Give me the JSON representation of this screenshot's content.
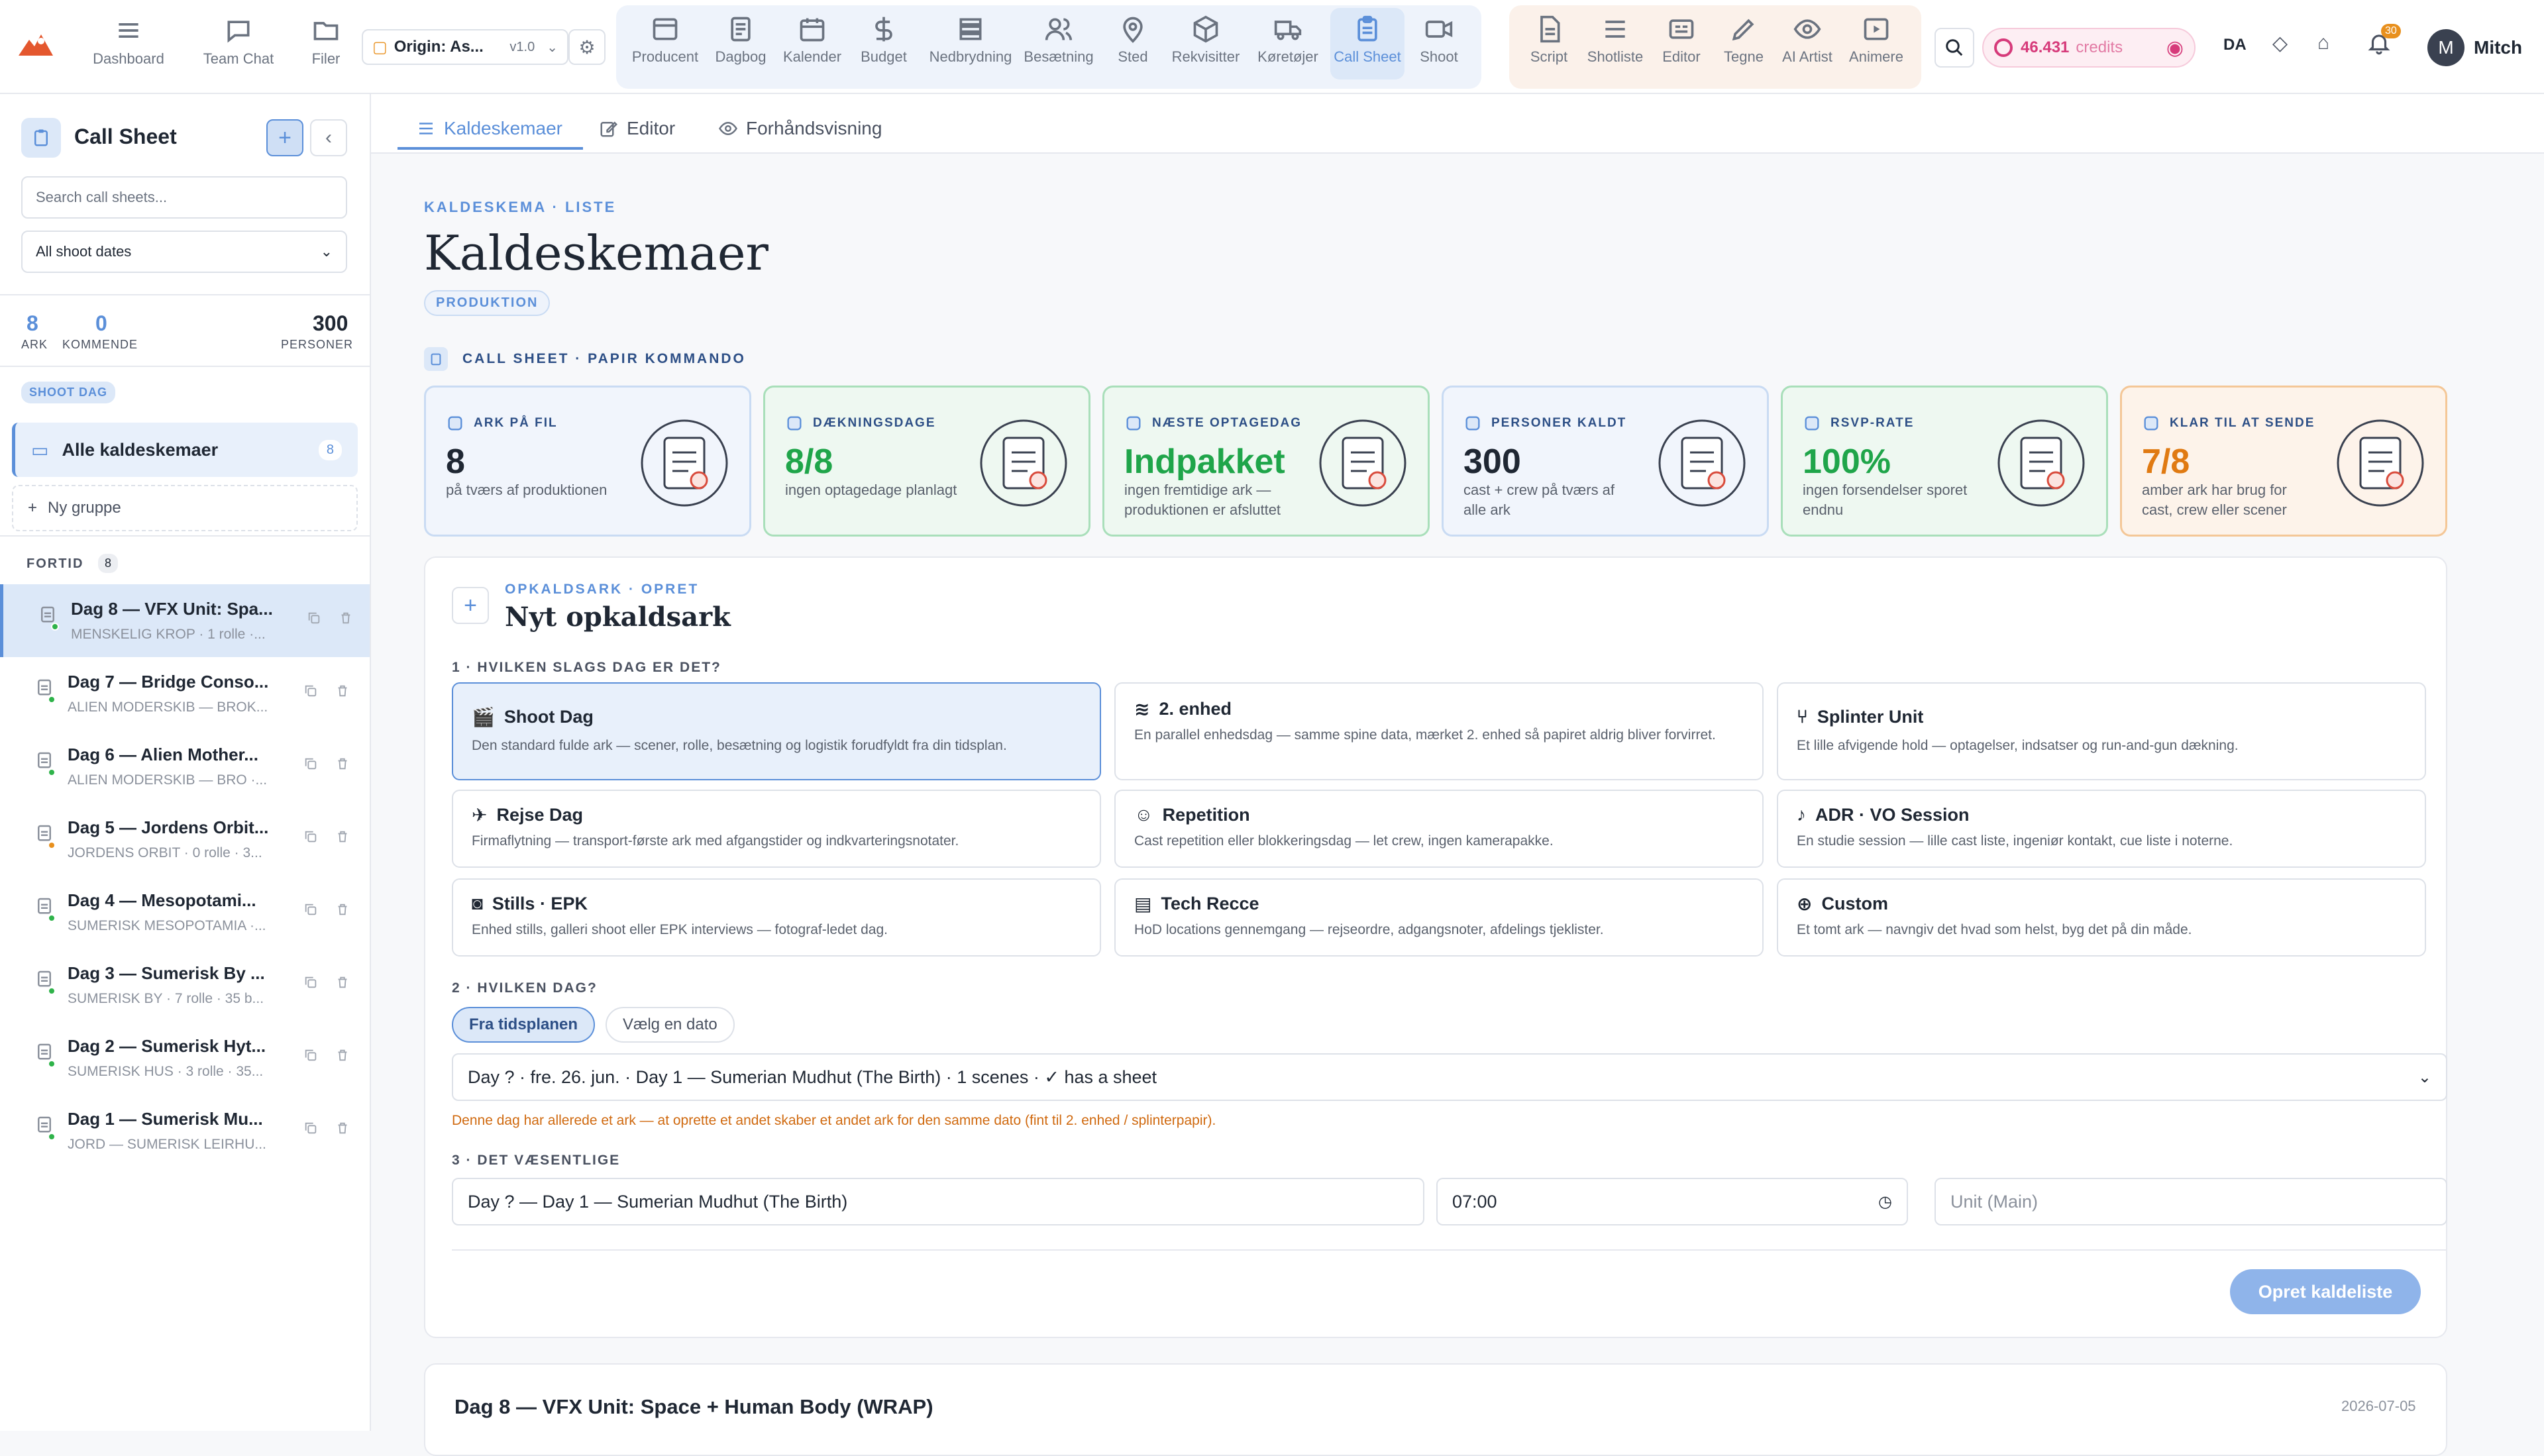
{
  "topbar": {
    "nav": [
      {
        "label": "Dashboard",
        "icon": "grid-icon"
      },
      {
        "label": "Team Chat",
        "icon": "chat-icon"
      },
      {
        "label": "Filer",
        "icon": "folder-icon"
      }
    ],
    "project": {
      "name": "Origin: As...",
      "version": "v1.0"
    },
    "tools_blue": [
      {
        "label": "Producent",
        "icon": "window-icon"
      },
      {
        "label": "Dagbog",
        "icon": "document-icon"
      },
      {
        "label": "Kalender",
        "icon": "calendar-icon"
      },
      {
        "label": "Budget",
        "icon": "dollar-icon"
      },
      {
        "label": "Nedbrydning",
        "icon": "stack-icon"
      },
      {
        "label": "Besætning",
        "icon": "people-icon"
      },
      {
        "label": "Sted",
        "icon": "pin-icon"
      },
      {
        "label": "Rekvisitter",
        "icon": "box-icon"
      },
      {
        "label": "Køretøjer",
        "icon": "truck-icon"
      },
      {
        "label": "Call Sheet",
        "icon": "clipboard-icon"
      },
      {
        "label": "Shoot",
        "icon": "camera-icon"
      }
    ],
    "tools_orange": [
      {
        "label": "Script",
        "icon": "script-icon"
      },
      {
        "label": "Shotliste",
        "icon": "list-icon"
      },
      {
        "label": "Editor",
        "icon": "editor-icon"
      },
      {
        "label": "Tegne",
        "icon": "pencil-icon"
      },
      {
        "label": "AI Artist",
        "icon": "eye-icon"
      },
      {
        "label": "Animere",
        "icon": "play-icon"
      }
    ],
    "credits": "46.431",
    "credits_label": "credits",
    "lang": "DA",
    "notifications": "30",
    "user_initial": "M",
    "user_name": "Mitch"
  },
  "sidebar": {
    "title": "Call Sheet",
    "search_placeholder": "Search call sheets...",
    "filter": "All shoot dates",
    "stats": [
      {
        "num": "8",
        "label": "ARK"
      },
      {
        "num": "0",
        "label": "KOMMENDE"
      },
      {
        "num": "300",
        "label": "PERSONER"
      }
    ],
    "shoot_tag": "SHOOT DAG",
    "all_label": "Alle kaldeskemaer",
    "all_count": "8",
    "new_group": "Ny gruppe",
    "past_label": "FORTID",
    "past_count": "8",
    "sheets": [
      {
        "title": "Dag 8 — VFX Unit: Spa...",
        "sub": "MENSKELIG KROP · 1 rolle ·...",
        "dot": "#2fb34a"
      },
      {
        "title": "Dag 7 — Bridge Conso...",
        "sub": "ALIEN MODERSKIB — BROK...",
        "dot": "#2fb34a"
      },
      {
        "title": "Dag 6 — Alien Mother...",
        "sub": "ALIEN MODERSKIB — BRO ·...",
        "dot": "#2fb34a"
      },
      {
        "title": "Dag 5 — Jordens Orbit...",
        "sub": "JORDENS ORBIT · 0 rolle · 3...",
        "dot": "#e8901e"
      },
      {
        "title": "Dag 4 — Mesopotami...",
        "sub": "SUMERISK MESOPOTAMIA ·...",
        "dot": "#2fb34a"
      },
      {
        "title": "Dag 3 — Sumerisk By ...",
        "sub": "SUMERISK BY · 7 rolle · 35 b...",
        "dot": "#2fb34a"
      },
      {
        "title": "Dag 2 — Sumerisk Hyt...",
        "sub": "SUMERISK HUS · 3 rolle · 35...",
        "dot": "#2fb34a"
      },
      {
        "title": "Dag 1 — Sumerisk Mu...",
        "sub": "JORD — SUMERISK LEIRHU...",
        "dot": "#2fb34a"
      }
    ]
  },
  "tabs": [
    {
      "label": "Kaldeskemaer",
      "icon": "list-icon"
    },
    {
      "label": "Editor",
      "icon": "edit-icon"
    },
    {
      "label": "Forhåndsvisning",
      "icon": "eye-icon"
    }
  ],
  "header": {
    "crumb": "KALDESKEMA · LISTE",
    "title": "Kaldeskemaer",
    "badge": "PRODUKTION",
    "sublabel": "CALL SHEET · PAPIR KOMMANDO"
  },
  "kpis": [
    {
      "label": "ARK PÅ FIL",
      "value": "8",
      "desc": "på tværs af produktionen",
      "theme": "blue"
    },
    {
      "label": "DÆKNINGSDAGE",
      "value": "8/8",
      "desc": "ingen optagedage planlagt",
      "theme": "green"
    },
    {
      "label": "NÆSTE OPTAGEDAG",
      "value": "Indpakket",
      "desc": "ingen fremtidige ark — produktionen er afsluttet",
      "theme": "green"
    },
    {
      "label": "PERSONER KALDT",
      "value": "300",
      "desc": "cast + crew på tværs af alle ark",
      "theme": "blue"
    },
    {
      "label": "RSVP-RATE",
      "value": "100%",
      "desc": "ingen forsendelser sporet endnu",
      "theme": "green"
    },
    {
      "label": "KLAR TIL AT SENDE",
      "value": "7/8",
      "desc": "amber ark har brug for cast, crew eller scener",
      "theme": "orange"
    }
  ],
  "newsheet": {
    "crumb": "OPKALDSARK · OPRET",
    "title": "Nyt opkaldsark",
    "q1": "1 · HVILKEN SLAGS DAG ER DET?",
    "types": [
      {
        "title": "Shoot Dag",
        "desc": "Den standard fulde ark — scener, rolle, besætning og logistik forudfyldt fra din tidsplan.",
        "icon": "clapper-icon",
        "selected": true
      },
      {
        "title": "2. enhed",
        "desc": "En parallel enhedsdag — samme spine data, mærket 2. enhed så papiret aldrig bliver forvirret.",
        "icon": "layers-icon",
        "selected": false
      },
      {
        "title": "Splinter Unit",
        "desc": "Et lille afvigende hold — optagelser, indsatser og run-and-gun dækning.",
        "icon": "branch-icon",
        "selected": false
      },
      {
        "title": "Rejse Dag",
        "desc": "Firmaflytning — transport-første ark med afgangstider og indkvarteringsnotater.",
        "icon": "plane-icon",
        "selected": false
      },
      {
        "title": "Repetition",
        "desc": "Cast repetition eller blokkeringsdag — let crew, ingen kamerapakke.",
        "icon": "masks-icon",
        "selected": false
      },
      {
        "title": "ADR · VO Session",
        "desc": "En studie session — lille cast liste, ingeniør kontakt, cue liste i noterne.",
        "icon": "mic-icon",
        "selected": false
      },
      {
        "title": "Stills · EPK",
        "desc": "Enhed stills, galleri shoot eller EPK interviews — fotograf-ledet dag.",
        "icon": "photo-camera-icon",
        "selected": false
      },
      {
        "title": "Tech Recce",
        "desc": "HoD locations gennemgang — rejseordre, adgangsnoter, afdelings tjeklister.",
        "icon": "map-icon",
        "selected": false
      },
      {
        "title": "Custom",
        "desc": "Et tomt ark — navngiv det hvad som helst, byg det på din måde.",
        "icon": "file-plus-icon",
        "selected": false
      }
    ],
    "q2": "2 · HVILKEN DAG?",
    "mode_a": "Fra tidsplanen",
    "mode_b": "Vælg en dato",
    "day_select": "Day ? · fre. 26. jun. · Day 1 — Sumerian Mudhut (The Birth) · 1 scenes · ✓ has a sheet",
    "warning": "Denne dag har allerede et ark — at oprette et andet skaber et andet ark for den samme dato (fint til 2. enhed / splinterpapir).",
    "q3": "3 · DET VÆSENTLIGE",
    "name_value": "Day ? — Day 1 — Sumerian Mudhut (The Birth)",
    "time_value": "07:00",
    "unit_placeholder": "Unit (Main)",
    "create_label": "Opret kaldeliste"
  },
  "sheetcard": {
    "title": "Dag 8 — VFX Unit: Space + Human Body (WRAP)",
    "date": "2026-07-05"
  },
  "colors": {
    "accent": "#5b8fd9",
    "green": "#1fa54a",
    "orange": "#e07a12",
    "pink": "#d63a7a"
  }
}
